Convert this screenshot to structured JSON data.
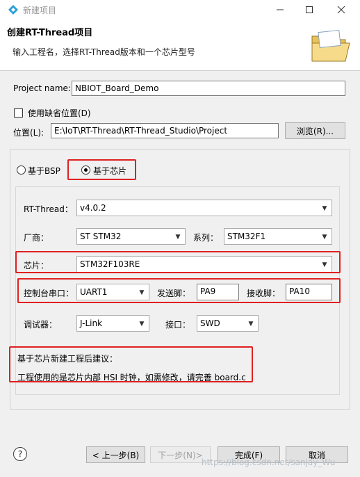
{
  "window": {
    "title": "新建项目",
    "minimize_icon": "minimize-icon",
    "maximize_icon": "maximize-icon",
    "close_icon": "close-icon"
  },
  "banner": {
    "title": "创建RT-Thread项目",
    "description": "输入工程名，选择RT-Thread版本和一个芯片型号",
    "icon": "folder-icon"
  },
  "project": {
    "name_label": "Project name:",
    "name_value": "NBIOT_Board_Demo",
    "default_location_label": "使用缺省位置(D)",
    "default_location_checked": false,
    "location_label": "位置(L):",
    "location_value": "E:\\IoT\\RT-Thread\\RT-Thread_Studio\\Project",
    "browse_label": "浏览(R)..."
  },
  "mode": {
    "bsp_label": "基于BSP",
    "chip_label": "基于芯片",
    "selected": "chip"
  },
  "chip_settings": {
    "rtthread_label": "RT-Thread：",
    "rtthread_value": "v4.0.2",
    "vendor_label": "厂商：",
    "vendor_value": "ST STM32",
    "series_label": "系列：",
    "series_value": "STM32F1",
    "chip_label": "芯片：",
    "chip_value": "STM32F103RE",
    "console_label": "控制台串口：",
    "console_value": "UART1",
    "tx_label": "发送脚：",
    "tx_value": "PA9",
    "rx_label": "接收脚：",
    "rx_value": "PA10",
    "debugger_label": "调试器：",
    "debugger_value": "J-Link",
    "interface_label": "接口：",
    "interface_value": "SWD"
  },
  "advice": {
    "title": "基于芯片新建工程后建议：",
    "text": "工程使用的是芯片内部 HSI 时钟，如需修改，请完善 board.c"
  },
  "footer": {
    "help_icon": "help-icon",
    "back_label": "< 上一步(B)",
    "next_label": "下一步(N)>",
    "finish_label": "完成(F)",
    "cancel_label": "取消",
    "watermark": "https://blog.csdn.net/sanjay_Wu"
  },
  "colors": {
    "highlight_red": "#e02020",
    "window_bg": "#f0f0f0",
    "banner_bg": "#ffffff"
  }
}
